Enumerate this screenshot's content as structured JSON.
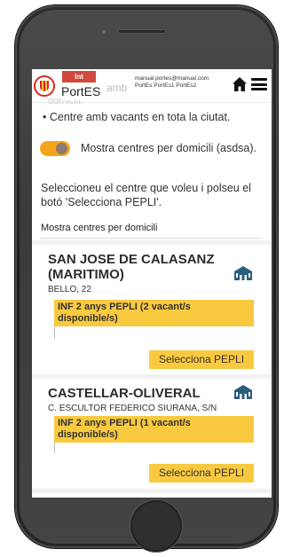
{
  "header": {
    "brand_badge": "Int",
    "brand_name": "PortES",
    "ghost_text": "amb",
    "ghost_text2": "domicili.",
    "user_email": "manual.portes@manual.com",
    "user_roles": "PortEs PortEs1 PortEs2",
    "home_icon": "home-icon",
    "menu_icon": "hamburger-menu-icon"
  },
  "filters": {
    "bullet_text": "• Centre amb vacants en tota la ciutat.",
    "toggle_on": true,
    "toggle_label": "Mostra centres per domicili (asdsa)."
  },
  "instructions": "Seleccioneu el centre que voleu i polseu el botó 'Selecciona PEPLI'.",
  "section_title": "Mostra centres per domicili",
  "centers": [
    {
      "name": "SAN JOSE DE CALASANZ (MARITIMO)",
      "address": "BELLO, 22",
      "info": "INF 2 anys PEPLI (2 vacant/s disponible/s)",
      "button": "Selecciona PEPLI",
      "icon": "school-building-icon"
    },
    {
      "name": "CASTELLAR-OLIVERAL",
      "address": "C. ESCULTOR FEDERICO SIURANA, S/N",
      "info": "INF 2 anys PEPLI (1 vacant/s disponible/s)",
      "button": "Selecciona PEPLI",
      "icon": "school-building-icon"
    }
  ],
  "colors": {
    "accent": "#f9c940",
    "toggle": "#f5a31a",
    "brand_red": "#cf4a3b"
  }
}
